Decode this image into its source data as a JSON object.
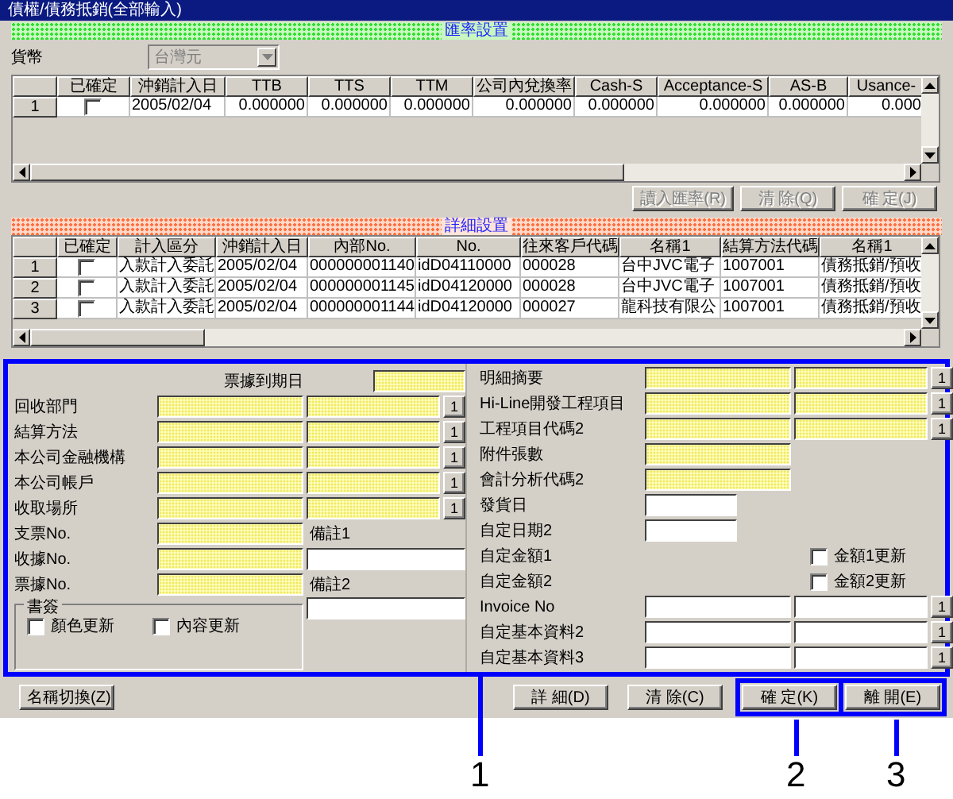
{
  "window": {
    "title": "債權/債務抵銷(全部輸入)"
  },
  "rate_section": {
    "title": "匯率設置",
    "currency": {
      "label": "貨幣",
      "value": "台灣元",
      "disabled": true
    },
    "table": {
      "columns": [
        "已確定",
        "沖銷計入日",
        "TTB",
        "TTS",
        "TTM",
        "公司內兌換率",
        "Cash-S",
        "Acceptance-S",
        "AS-B",
        "Usance-"
      ],
      "rows": [
        {
          "header": "1",
          "confirmed": false,
          "cells": [
            "",
            "2005/02/04",
            "0.000000",
            "0.000000",
            "0.000000",
            "0.000000",
            "0.000000",
            "0.000000",
            "0.000000",
            "0.000"
          ]
        }
      ]
    },
    "buttons": [
      {
        "label": "讀入匯率(R)",
        "disabled": true
      },
      {
        "label": "清 除(Q)",
        "disabled": true
      },
      {
        "label": "確 定(J)",
        "disabled": true
      }
    ]
  },
  "detail_section": {
    "title": "詳細設置",
    "table": {
      "columns": [
        "已確定",
        "計入區分",
        "沖銷計入日",
        "內部No.",
        "No.",
        "往來客戶代碼",
        "名稱1",
        "結算方法代碼",
        "名稱1"
      ],
      "rows": [
        {
          "header": "1",
          "confirmed": false,
          "cells": [
            "",
            "入款計入委託",
            "2005/02/04",
            "000000001140",
            "idD04110000",
            "000028",
            "台中JVC電子",
            "1007001",
            "債務抵銷/預收"
          ]
        },
        {
          "header": "2",
          "confirmed": false,
          "cells": [
            "",
            "入款計入委託",
            "2005/02/04",
            "000000001145",
            "idD04120000",
            "000028",
            "台中JVC電子",
            "1007001",
            "債務抵銷/預收"
          ]
        },
        {
          "header": "3",
          "confirmed": false,
          "cells": [
            "",
            "入款計入委託",
            "2005/02/04",
            "000000001144",
            "idD04120000",
            "000027",
            "龍科技有限公",
            "1007001",
            "債務抵銷/預收"
          ]
        }
      ]
    }
  },
  "form": {
    "highlighted": true,
    "due_date": {
      "label": "票據到期日",
      "required": true
    },
    "left_rows": [
      {
        "kind": "pair",
        "label": "回收部門",
        "required": true,
        "lookup": "1"
      },
      {
        "kind": "pair",
        "label": "結算方法",
        "required": true,
        "lookup": "1"
      },
      {
        "kind": "pair",
        "label": "本公司金融機構",
        "required": true,
        "lookup": "1"
      },
      {
        "kind": "pair",
        "label": "本公司帳戶",
        "required": true,
        "lookup": "1"
      },
      {
        "kind": "pair",
        "label": "收取場所",
        "required": true,
        "lookup": "1"
      },
      {
        "kind": "single",
        "label": "支票No.",
        "required": true,
        "side": {
          "kind": "label",
          "text": "備註1"
        }
      },
      {
        "kind": "single",
        "label": "收據No.",
        "required": true,
        "side": {
          "kind": "field"
        }
      },
      {
        "kind": "single",
        "label": "票據No.",
        "required": true,
        "side": {
          "kind": "label",
          "text": "備註2"
        }
      }
    ],
    "bookmark": {
      "title": "書簽",
      "options": [
        {
          "label": "顏色更新",
          "checked": false
        },
        {
          "label": "內容更新",
          "checked": false
        }
      ],
      "side": {
        "kind": "field"
      }
    },
    "right_rows": [
      {
        "kind": "pair",
        "label": "明細摘要",
        "required": true,
        "lookup": "1"
      },
      {
        "kind": "pair",
        "label": "Hi-Line開發工程項目",
        "required": true,
        "lookup": "1"
      },
      {
        "kind": "pair",
        "label": "工程項目代碼2",
        "required": true,
        "lookup": "1"
      },
      {
        "kind": "single",
        "label": "附件張數",
        "required": true
      },
      {
        "kind": "single",
        "label": "會計分析代碼2",
        "required": true
      },
      {
        "kind": "date",
        "label": "發貨日",
        "required": false
      },
      {
        "kind": "date",
        "label": "自定日期2",
        "required": false
      },
      {
        "kind": "check",
        "label": "自定金額1",
        "option": {
          "label": "金額1更新",
          "checked": false
        }
      },
      {
        "kind": "check",
        "label": "自定金額2",
        "option": {
          "label": "金額2更新",
          "checked": false
        }
      },
      {
        "kind": "pair",
        "label": "Invoice No",
        "required": false,
        "lookup": "1"
      },
      {
        "kind": "pair",
        "label": "自定基本資料2",
        "required": false,
        "lookup": "1"
      },
      {
        "kind": "pair",
        "label": "自定基本資料3",
        "required": false,
        "lookup": "1"
      }
    ]
  },
  "footer_buttons": [
    {
      "label": "名稱切換(Z)",
      "highlighted": false
    },
    {
      "label": "詳 細(D)",
      "highlighted": false
    },
    {
      "label": "清 除(C)",
      "highlighted": false
    },
    {
      "label": "確 定(K)",
      "highlighted": true
    },
    {
      "label": "離 開(E)",
      "highlighted": true
    }
  ],
  "callouts": [
    "1",
    "2",
    "3"
  ]
}
